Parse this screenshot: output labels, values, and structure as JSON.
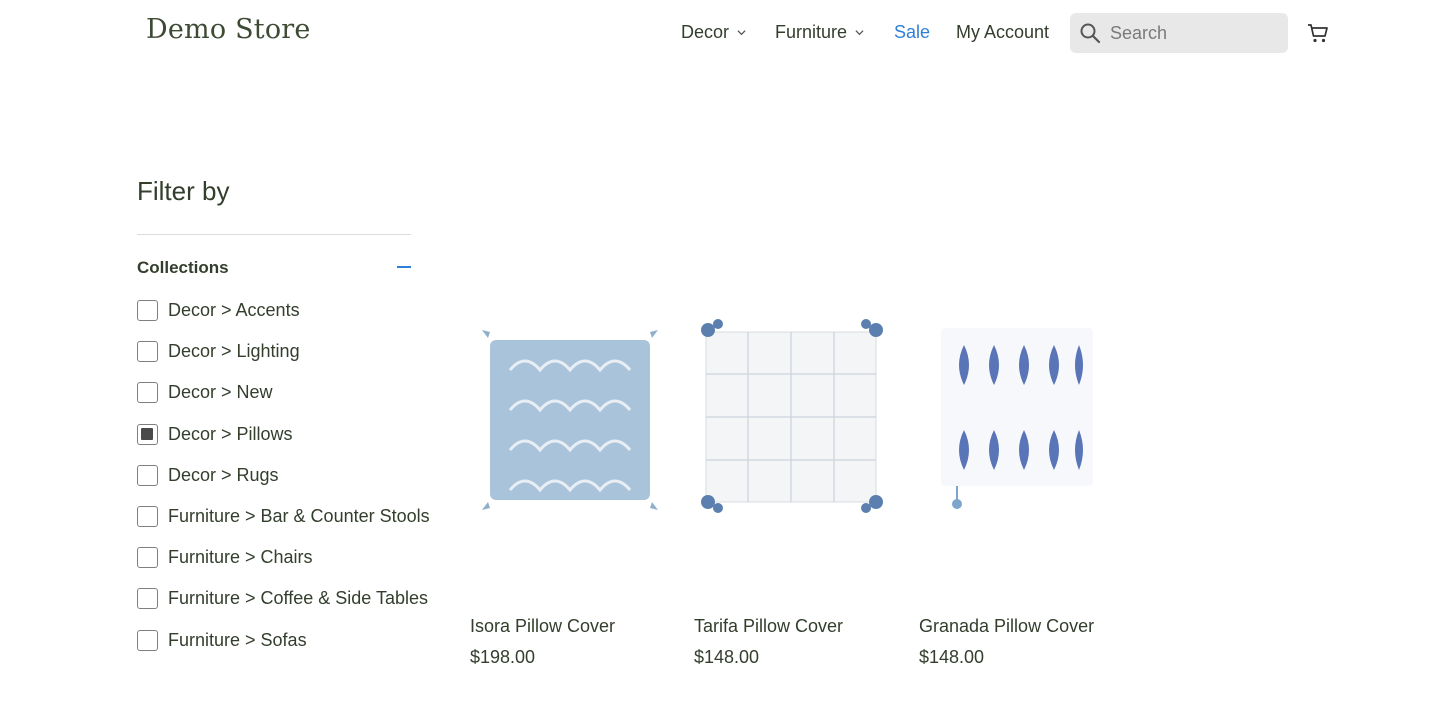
{
  "header": {
    "logo": "Demo Store",
    "nav": [
      {
        "label": "Decor",
        "has_dropdown": true
      },
      {
        "label": "Furniture",
        "has_dropdown": true
      },
      {
        "label": "Sale",
        "has_dropdown": false,
        "color": "#2f7fd8"
      },
      {
        "label": "My Account",
        "has_dropdown": false
      }
    ],
    "search": {
      "placeholder": "Search",
      "value": "",
      "icon": "search-icon"
    },
    "cart_icon": "cart-icon"
  },
  "sidebar": {
    "title": "Filter by",
    "collections": {
      "heading": "Collections",
      "toggle_icon": "minus-icon",
      "items": [
        {
          "label": "Decor > Accents",
          "checked": false
        },
        {
          "label": "Decor > Lighting",
          "checked": false
        },
        {
          "label": "Decor > New",
          "checked": false
        },
        {
          "label": "Decor > Pillows",
          "checked": true
        },
        {
          "label": "Decor > Rugs",
          "checked": false
        },
        {
          "label": "Furniture > Bar & Counter Stools",
          "checked": false
        },
        {
          "label": "Furniture > Chairs",
          "checked": false
        },
        {
          "label": "Furniture > Coffee & Side Tables",
          "checked": false
        },
        {
          "label": "Furniture > Sofas",
          "checked": false
        }
      ]
    }
  },
  "products": [
    {
      "name": "Isora Pillow Cover",
      "price": "$198.00"
    },
    {
      "name": "Tarifa Pillow Cover",
      "price": "$148.00"
    },
    {
      "name": "Granada Pillow Cover",
      "price": "$148.00"
    }
  ],
  "colors": {
    "text": "#333e2c",
    "accent": "#2f7fd8",
    "search_bg": "#e8e8e8"
  }
}
